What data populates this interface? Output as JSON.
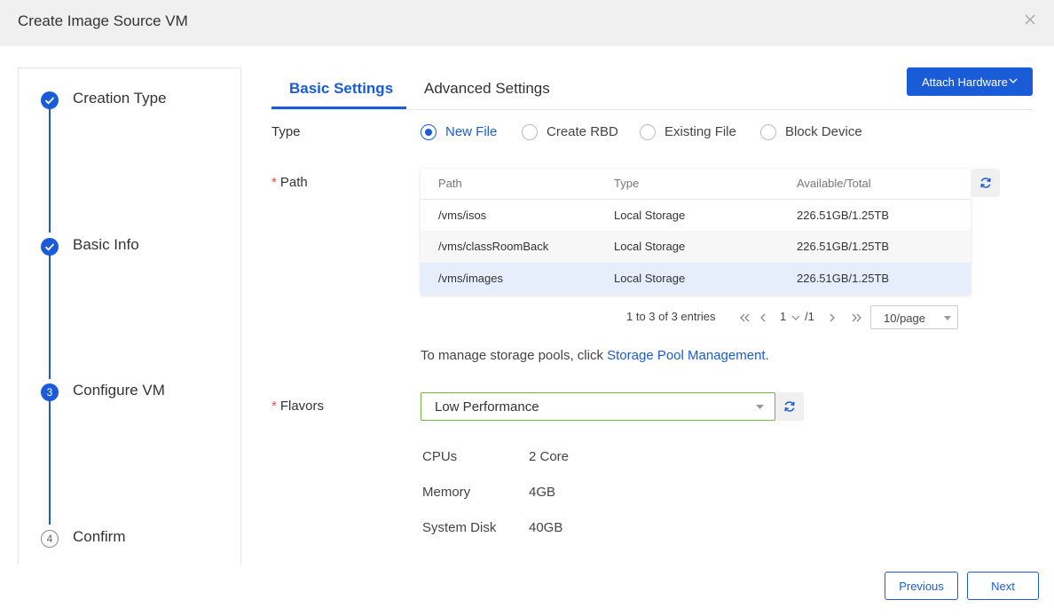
{
  "dialog": {
    "title": "Create Image Source VM"
  },
  "steps": [
    {
      "label": "Creation Type",
      "status": "done"
    },
    {
      "label": "Basic Info",
      "status": "done"
    },
    {
      "label": "Configure VM",
      "status": "current",
      "number": "3"
    },
    {
      "label": "Confirm",
      "status": "pending",
      "number": "4"
    }
  ],
  "tabs": [
    {
      "label": "Basic Settings",
      "active": true
    },
    {
      "label": "Advanced Settings",
      "active": false
    }
  ],
  "attach_hardware": {
    "label": "Attach Hardware"
  },
  "form": {
    "type_label": "Type",
    "type_options": [
      "New File",
      "Create RBD",
      "Existing File",
      "Block Device"
    ],
    "type_selected": "New File",
    "path_label": "Path",
    "flavors_label": "Flavors",
    "required_mark": "*"
  },
  "path_table": {
    "columns": [
      "Path",
      "Type",
      "Available/Total"
    ],
    "rows": [
      {
        "path": "/vms/isos",
        "type": "Local Storage",
        "available": "226.51GB/1.25TB"
      },
      {
        "path": "/vms/classRoomBack",
        "type": "Local Storage",
        "available": "226.51GB/1.25TB"
      },
      {
        "path": "/vms/images",
        "type": "Local Storage",
        "available": "226.51GB/1.25TB",
        "selected": true
      }
    ]
  },
  "pagination": {
    "summary": "1 to 3 of 3 entries",
    "current_page": "1",
    "total_pages": "/1",
    "page_size": "10/page"
  },
  "storage_note": {
    "text": "To manage storage pools, click ",
    "link": "Storage Pool Management",
    "suffix": "."
  },
  "flavor": {
    "selected": "Low Performance",
    "specs": [
      {
        "key": "CPUs",
        "value": "2 Core"
      },
      {
        "key": "Memory",
        "value": "4GB"
      },
      {
        "key": "System Disk",
        "value": "40GB"
      }
    ]
  },
  "footer": {
    "previous": "Previous",
    "next": "Next"
  },
  "colors": {
    "accent": "#1a5cd8",
    "required": "#e84c3d",
    "select_border": "#6dbb3c"
  }
}
